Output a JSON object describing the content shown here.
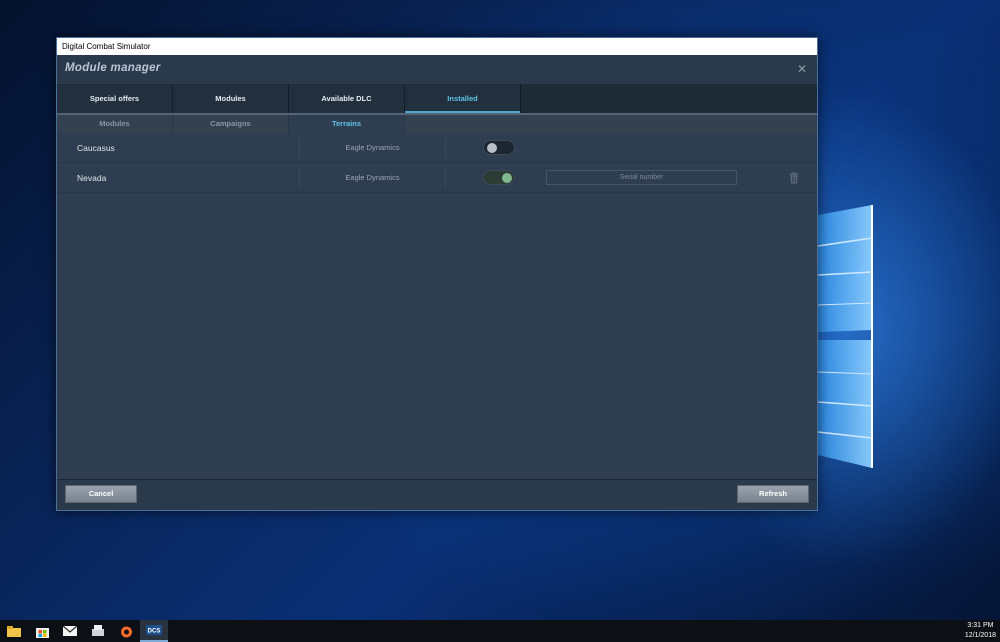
{
  "window": {
    "title": "Digital Combat Simulator"
  },
  "module_manager": {
    "title": "Module manager",
    "close_icon": "close-icon"
  },
  "main_tabs": [
    {
      "label": "Special offers",
      "active": false
    },
    {
      "label": "Modules",
      "active": false
    },
    {
      "label": "Available DLC",
      "active": false
    },
    {
      "label": "Installed",
      "active": true
    }
  ],
  "sub_tabs": [
    {
      "label": "Modules",
      "active": false
    },
    {
      "label": "Campaigns",
      "active": false
    },
    {
      "label": "Terrains",
      "active": true
    }
  ],
  "terrains": [
    {
      "name": "Caucasus",
      "vendor": "Eagle Dynamics",
      "enabled": false
    },
    {
      "name": "Nevada",
      "vendor": "Eagle Dynamics",
      "enabled": true,
      "serial_placeholder": "Serial number",
      "delete_icon": "trash-icon"
    }
  ],
  "footer": {
    "cancel_label": "Cancel",
    "refresh_label": "Refresh"
  },
  "taskbar": {
    "icons": [
      "file-explorer-icon",
      "store-icon",
      "mail-icon",
      "scanner-icon",
      "origin-icon",
      "dcs-icon"
    ],
    "time": "3:31 PM",
    "date": "12/1/2018"
  },
  "colors": {
    "accent": "#5fc4e8",
    "panel": "#2e3d4f",
    "toggle_on": "#7fb88e"
  }
}
